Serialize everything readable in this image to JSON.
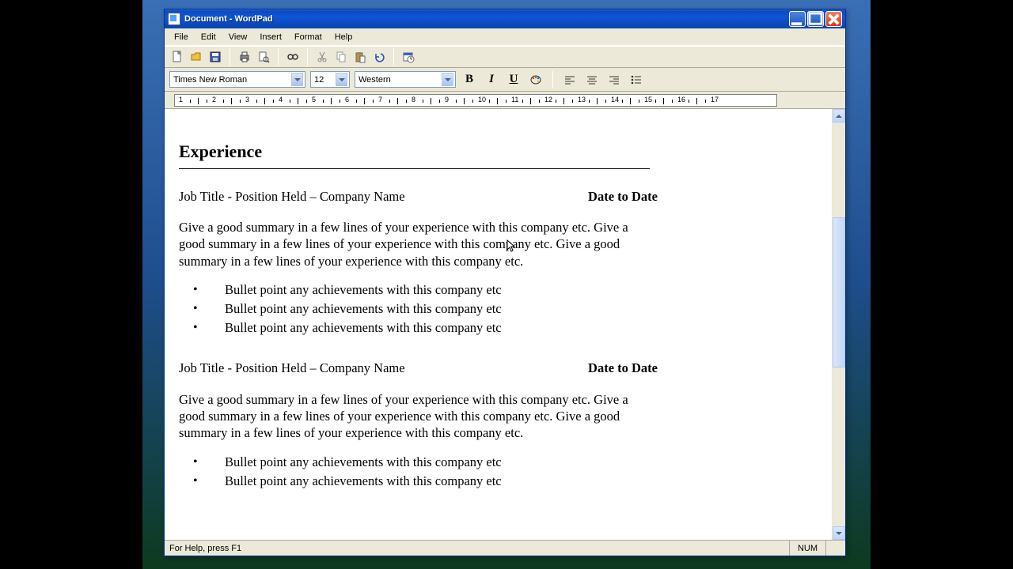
{
  "window": {
    "title": "Document - WordPad"
  },
  "menu": {
    "file": "File",
    "edit": "Edit",
    "view": "View",
    "insert": "Insert",
    "format": "Format",
    "help": "Help"
  },
  "format": {
    "font": "Times New Roman",
    "size": "12",
    "script": "Western",
    "bold": "B",
    "italic": "I",
    "underline": "U"
  },
  "ruler": {
    "nums": [
      "1",
      "2",
      "3",
      "4",
      "5",
      "6",
      "7",
      "8",
      "9",
      "10",
      "11",
      "12",
      "13",
      "14",
      "15",
      "16",
      "17"
    ]
  },
  "doc": {
    "heading": "Experience",
    "job1": {
      "title": "Job Title - Position Held – Company Name",
      "date": "Date to Date",
      "summary": "Give a good summary in a few lines of your experience with this company etc.  Give a good summary in a few lines of your experience with this company etc. Give a good summary in a few lines of your experience with this company etc.",
      "bullets": [
        "Bullet point any achievements with this company etc",
        "Bullet point any achievements with this company etc",
        "Bullet point any achievements with this company etc"
      ]
    },
    "job2": {
      "title": "Job Title - Position Held – Company Name",
      "date": "Date to Date",
      "summary": "Give a good summary in a few lines of your experience with this company etc.  Give a good summary in a few lines of your experience with this company etc. Give a good summary in a few lines of your experience with this company etc.",
      "bullets": [
        "Bullet point any achievements with this company etc",
        "Bullet point any achievements with this company etc"
      ]
    }
  },
  "status": {
    "help": "For Help, press F1",
    "num": "NUM"
  }
}
